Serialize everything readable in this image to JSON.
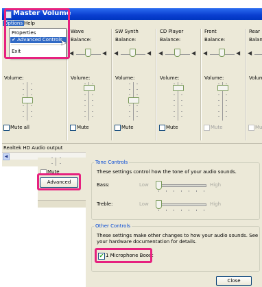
{
  "window": {
    "title": "Master Volume",
    "menu": [
      "Options",
      "Help"
    ],
    "dropdown": [
      "Properties",
      "Advanced Controls",
      "Exit"
    ],
    "dropdown_check": "✔",
    "status": "Realtek HD Audio output"
  },
  "channels": [
    {
      "name": "",
      "balance": "Balance:",
      "volume": "Volume:",
      "mute": "Mute all",
      "enabled": true
    },
    {
      "name": "Wave",
      "balance": "Balance:",
      "volume": "Volume:",
      "mute": "Mute",
      "enabled": true
    },
    {
      "name": "SW Synth",
      "balance": "Balance:",
      "volume": "Volume:",
      "mute": "Mute",
      "enabled": true
    },
    {
      "name": "CD Player",
      "balance": "Balance:",
      "volume": "Volume:",
      "mute": "Mute",
      "enabled": true
    },
    {
      "name": "Front",
      "balance": "Balance:",
      "volume": "Volume:",
      "mute": "Mute",
      "enabled": false
    },
    {
      "name": "Rear",
      "balance": "Balance",
      "volume": "Volume:",
      "mute": "Mut",
      "enabled": false
    }
  ],
  "advanced_button": "Advanced",
  "advanced": {
    "tone_group": "Tone Controls",
    "tone_desc": "These settings control how the tone of your audio sounds.",
    "bass": "Bass:",
    "treble": "Treble:",
    "low": "Low",
    "high": "High",
    "other_group": "Other Controls",
    "other_desc_1": "These settings make other changes to how your audio sounds.  See",
    "other_desc_2": "your hardware documentation for details.",
    "mic_boost": "1  Microphone Boost",
    "mic_checked": true,
    "close": "Close"
  },
  "colors": {
    "titlebar": "#0a3fd0",
    "highlight": "#e6217f",
    "group_title": "#0046d5",
    "selection": "#316ac5"
  },
  "icons": {
    "speaker_left": "speaker-left-icon",
    "speaker_right": "speaker-right-icon",
    "cursor": "mouse-cursor-icon",
    "scroll_left": "scroll-left-arrow-icon",
    "app": "volume-app-icon"
  }
}
